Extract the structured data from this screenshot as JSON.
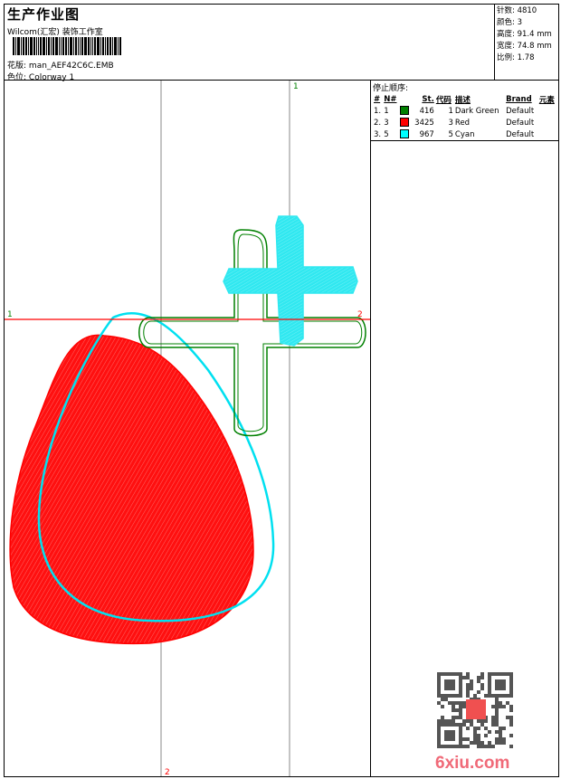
{
  "header": {
    "title": "生产作业图",
    "company": "Wilcom(汇宏) 装饰工作室",
    "design_label": "花版:",
    "design_value": "man_AEF42C6C.EMB",
    "colorway_label": "色位:",
    "colorway_value": "Colorway 1"
  },
  "stats": [
    {
      "label": "针数:",
      "value": "4810"
    },
    {
      "label": "颜色:",
      "value": "3"
    },
    {
      "label": "高度:",
      "value": "91.4 mm"
    },
    {
      "label": "宽度:",
      "value": "74.8 mm"
    },
    {
      "label": "比例:",
      "value": "1.78"
    }
  ],
  "stop_sequence": {
    "title": "停止顺序:",
    "headers": [
      "#",
      "N#",
      "",
      "St.",
      "代码",
      "描述",
      "Brand",
      "元素"
    ],
    "rows": [
      {
        "num": "1.",
        "n": "1",
        "color": "#008000",
        "st": "416",
        "code": "1",
        "desc": "Dark Green",
        "brand": "Default"
      },
      {
        "num": "2.",
        "n": "3",
        "color": "#ff0000",
        "st": "3425",
        "code": "3",
        "desc": "Red",
        "brand": "Default"
      },
      {
        "num": "3.",
        "n": "5",
        "color": "#00ffff",
        "st": "967",
        "code": "5",
        "desc": "Cyan",
        "brand": "Default"
      }
    ]
  },
  "axis_markers": {
    "top": "1",
    "bottom": "2",
    "left": "1",
    "right": "2"
  },
  "watermark": "6xiu.com"
}
